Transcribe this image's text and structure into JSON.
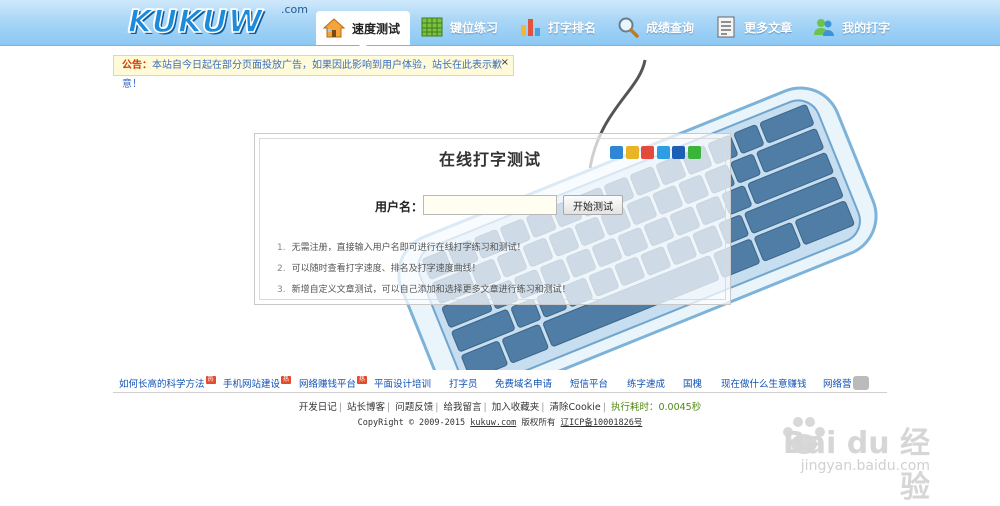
{
  "logo": {
    "text": "KUKUW",
    "suffix": ".com"
  },
  "nav": [
    {
      "label": "速度测试",
      "icon": "house-icon",
      "active": true
    },
    {
      "label": "键位练习",
      "icon": "keyboard-grid-icon",
      "active": false
    },
    {
      "label": "打字排名",
      "icon": "bar-chart-icon",
      "active": false
    },
    {
      "label": "成绩查询",
      "icon": "magnifier-icon",
      "active": false
    },
    {
      "label": "更多文章",
      "icon": "document-icon",
      "active": false
    },
    {
      "label": "我的打字",
      "icon": "users-icon",
      "active": false
    }
  ],
  "notice": {
    "label": "公告：",
    "text": "本站自今日起在部分页面投放广告，如果因此影响到用户体验，站长在此表示歉意！",
    "close": "×"
  },
  "panel": {
    "title": "在线打字测试",
    "share_icons": [
      "plus-icon",
      "star-icon",
      "weibo-icon",
      "qzone-icon",
      "renren-icon",
      "wechat-icon"
    ],
    "username_label": "用户名：",
    "username_value": "",
    "start_button": "开始测试",
    "tips": [
      {
        "num": "1.",
        "text": "无需注册，直接输入用户名即可进行在线打字练习和测试！"
      },
      {
        "num": "2.",
        "text": "可以随时查看打字速度、排名及打字速度曲线！"
      },
      {
        "num": "3.",
        "text": "新增自定义文章测试，可以自己添加和选择更多文章进行练习和测试！"
      }
    ]
  },
  "links": [
    {
      "text": "如何长高的科学方法",
      "hot": true
    },
    {
      "text": "手机网站建设",
      "hot": true
    },
    {
      "text": "网络赚钱平台",
      "hot": true
    },
    {
      "text": "平面设计培训",
      "hot": false
    },
    {
      "text": "打字员",
      "hot": false
    },
    {
      "text": "免费域名申请",
      "hot": false
    },
    {
      "text": "短信平台",
      "hot": false
    },
    {
      "text": "练字速成",
      "hot": false
    },
    {
      "text": "国槐",
      "hot": false
    },
    {
      "text": "现在做什么生意赚钱",
      "hot": false
    },
    {
      "text": "网络营",
      "hot": false
    }
  ],
  "hot_badge": "热",
  "sublinks": [
    "开发日记",
    "站长博客",
    "问题反馈",
    "给我留言",
    "加入收藏夹",
    "清除Cookie"
  ],
  "timing": "执行耗时：0.0045秒",
  "copyright": {
    "prefix": "CopyRight © 2009-2015",
    "site": "kukuw.com",
    "rights": "版权所有",
    "icp": "辽ICP备10001826号"
  },
  "watermark": {
    "brand": "Bai du 经验",
    "url": "jingyan.baidu.com"
  },
  "colors": {
    "header": "#a9d6f7",
    "link": "#1152b5",
    "notice_bg": "#fffbd8",
    "hot": "#e24b2e"
  }
}
